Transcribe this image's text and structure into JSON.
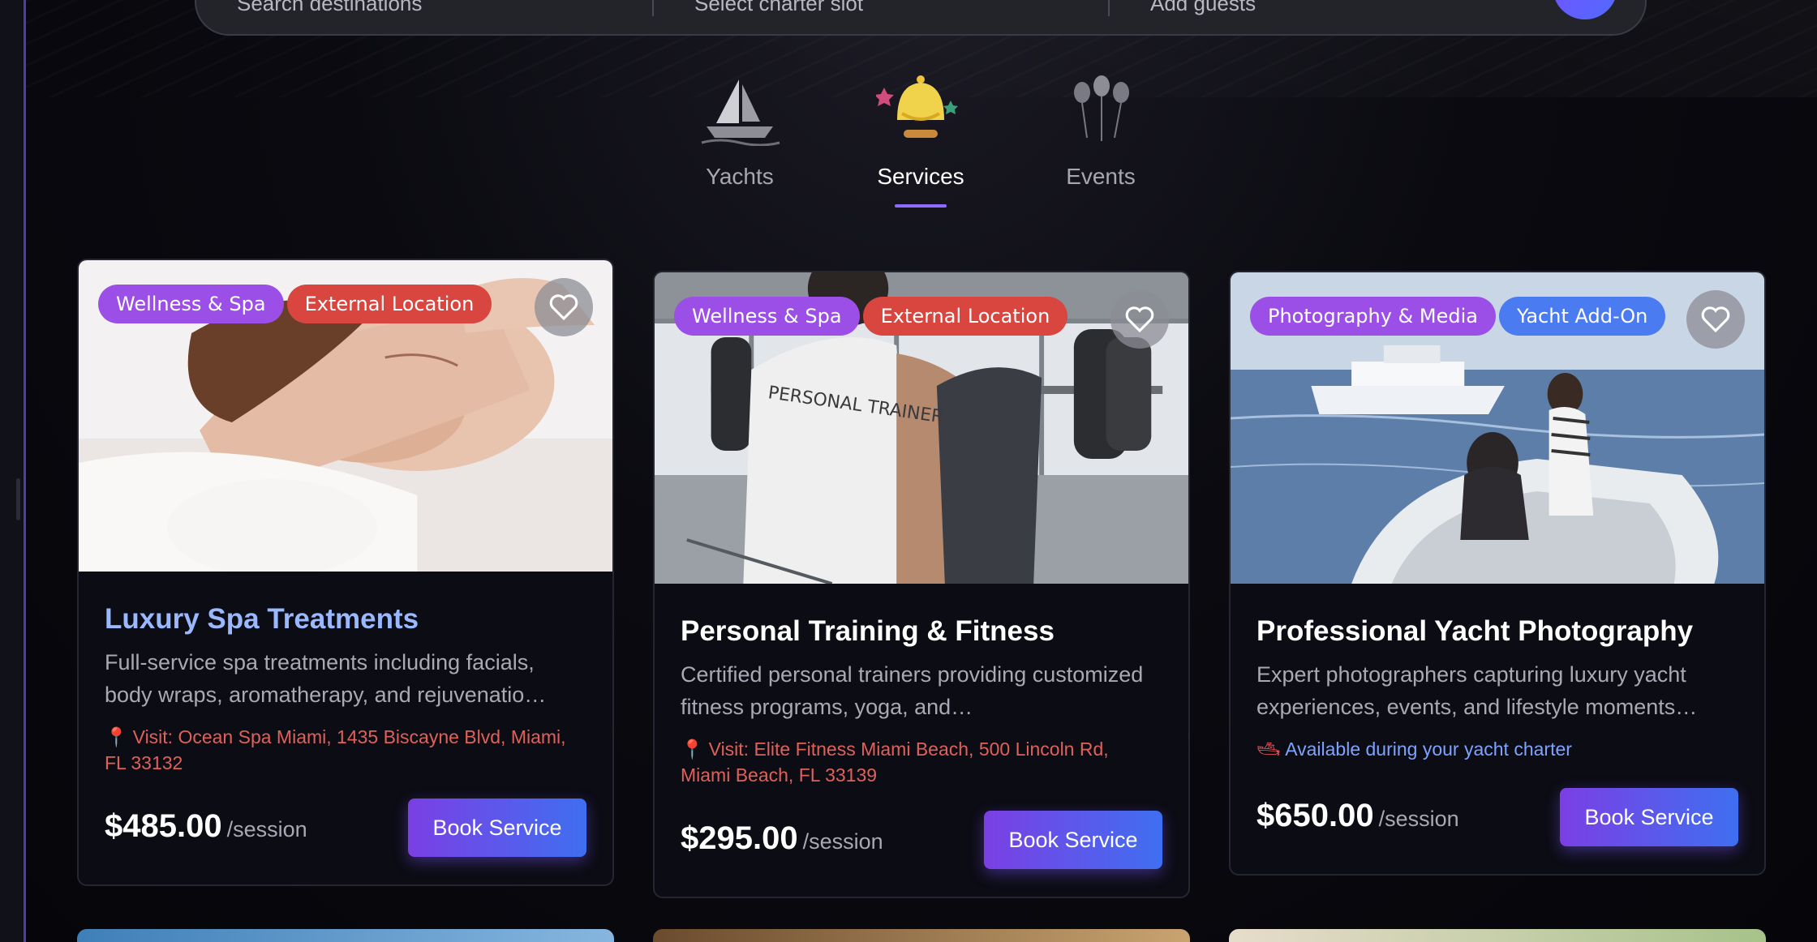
{
  "search": {
    "destination_placeholder": "Search destinations",
    "slot_placeholder": "Select charter slot",
    "guests_placeholder": "Add guests"
  },
  "tabs": [
    {
      "label": "Yachts",
      "icon": "sailboat-icon",
      "active": false
    },
    {
      "label": "Services",
      "icon": "bell-service-icon",
      "active": true
    },
    {
      "label": "Events",
      "icon": "balloons-icon",
      "active": false
    }
  ],
  "cards": [
    {
      "badges": [
        "Wellness & Spa",
        "External Location"
      ],
      "title": "Luxury Spa Treatments",
      "description": "Full-service spa treatments including facials, body wraps, aromatherapy, and rejuvenatio…",
      "location": "Visit: Ocean Spa Miami, 1435 Biscayne Blvd, Miami, FL 33132",
      "price": "$485.00",
      "unit": "/session",
      "button": "Book Service"
    },
    {
      "badges": [
        "Wellness & Spa",
        "External Location"
      ],
      "title": "Personal Training & Fitness",
      "description": "Certified personal trainers providing customized fitness programs, yoga, and…",
      "location": "Visit: Elite Fitness Miami Beach, 500 Lincoln Rd, Miami Beach, FL 33139",
      "shirt_text": "PERSONAL TRAINER",
      "price": "$295.00",
      "unit": "/session",
      "button": "Book Service"
    },
    {
      "badges": [
        "Photography & Media",
        "Yacht Add-On"
      ],
      "title": "Professional Yacht Photography",
      "description": "Expert photographers capturing luxury yacht experiences, events, and lifestyle moments…",
      "location": "Available during your yacht charter",
      "price": "$650.00",
      "unit": "/session",
      "button": "Book Service"
    }
  ],
  "colors": {
    "accent_purple": "#9b4fe6",
    "accent_red": "#d8463f",
    "accent_blue": "#4a7bf0",
    "button_gradient_start": "#7b3fe4",
    "button_gradient_end": "#3f6ff0"
  }
}
